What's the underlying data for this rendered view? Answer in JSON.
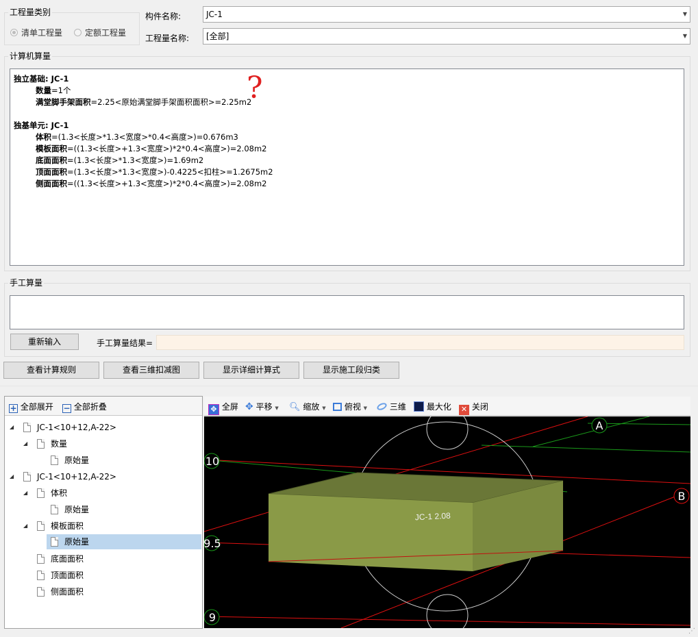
{
  "quantity_type": {
    "title": "工程量类别",
    "options": [
      "清单工程量",
      "定额工程量"
    ],
    "selected": "清单工程量"
  },
  "component": {
    "label": "构件名称:",
    "value": "JC-1"
  },
  "quantity_name": {
    "label": "工程量名称:",
    "value": "[全部]"
  },
  "computer_calc": {
    "title": "计算机算量",
    "lines": [
      {
        "prefix": "独立基础: JC-1",
        "text": ""
      },
      {
        "prefix": "数量",
        "text": "=1个"
      },
      {
        "prefix": "满堂脚手架面积",
        "text": "=2.25<原始满堂脚手架面积面积>=2.25m2"
      },
      {
        "prefix": "独基单元: JC-1",
        "text": ""
      },
      {
        "prefix": "体积",
        "text": "=(1.3<长度>*1.3<宽度>*0.4<高度>)=0.676m3"
      },
      {
        "prefix": "模板面积",
        "text": "=((1.3<长度>+1.3<宽度>)*2*0.4<高度>)=2.08m2"
      },
      {
        "prefix": "底面面积",
        "text": "=(1.3<长度>*1.3<宽度>)=1.69m2"
      },
      {
        "prefix": "顶面面积",
        "text": "=(1.3<长度>*1.3<宽度>)-0.4225<扣柱>=1.2675m2"
      },
      {
        "prefix": "侧面面积",
        "text": "=((1.3<长度>+1.3<宽度>)*2*0.4<高度>)=2.08m2"
      }
    ],
    "annotation": "?"
  },
  "manual_calc": {
    "title": "手工算量",
    "input_value": "",
    "reenter_label": "重新输入",
    "result_label": "手工算量结果=",
    "result_value": ""
  },
  "actions": [
    "查看计算规则",
    "查看三维扣减图",
    "显示详细计算式",
    "显示施工段归类"
  ],
  "tree_toolbar": {
    "expand_all": "全部展开",
    "collapse_all": "全部折叠"
  },
  "tree": [
    {
      "label": "JC-1<10+12,A-22>",
      "level": 0,
      "expanded": true
    },
    {
      "label": "数量",
      "level": 1,
      "expanded": true
    },
    {
      "label": "原始量",
      "level": 2
    },
    {
      "label": "JC-1<10+12,A-22>",
      "level": 0,
      "expanded": true
    },
    {
      "label": "体积",
      "level": 1,
      "expanded": true
    },
    {
      "label": "原始量",
      "level": 2
    },
    {
      "label": "模板面积",
      "level": 1,
      "expanded": true
    },
    {
      "label": "原始量",
      "level": 2,
      "selected": true
    },
    {
      "label": "底面面积",
      "level": 1
    },
    {
      "label": "顶面面积",
      "level": 1
    },
    {
      "label": "侧面面积",
      "level": 1
    }
  ],
  "viewer_toolbar": {
    "fullscreen": "全屏",
    "pan": "平移",
    "zoom": "缩放",
    "view": "俯视",
    "three_d": "三维",
    "maximize": "最大化",
    "close": "关闭"
  },
  "viewer": {
    "label": "JC-1 2.08",
    "axis_labels": [
      "A",
      "B",
      "10",
      "9.5",
      "9"
    ],
    "colors": {
      "background": "#000000",
      "box": "#8a9a47",
      "axis_red": "#e01010",
      "axis_green": "#1a9a1a",
      "circle": "#d0d0d0"
    }
  },
  "colors": {
    "accent_selection": "#bcd6ee",
    "annotation_red": "#e02020"
  }
}
